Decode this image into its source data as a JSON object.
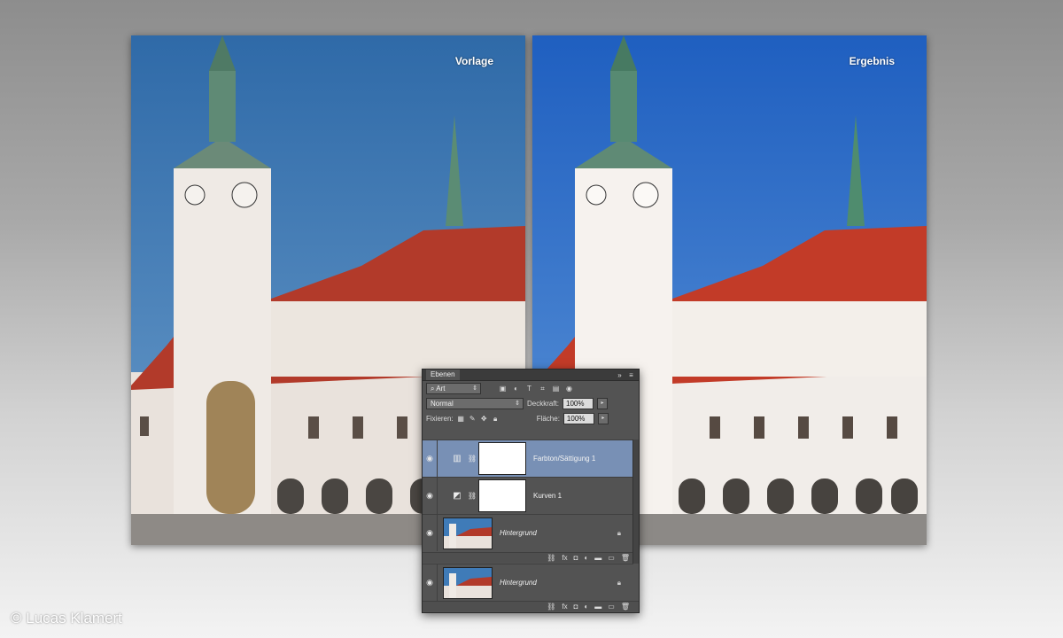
{
  "photos": {
    "left_label": "Vorlage",
    "right_label": "Ergebnis"
  },
  "credit": "© Lucas Klamert",
  "panel": {
    "tab": "Ebenen",
    "filter_kind": "Art",
    "blend_mode": "Normal",
    "opacity_label": "Deckkraft:",
    "opacity_value": "100%",
    "lock_label": "Fixieren:",
    "fill_label": "Fläche:",
    "fill_value": "100%",
    "layers": [
      {
        "name": "Farbton/Sättigung 1",
        "type": "adjustment",
        "selected": true
      },
      {
        "name": "Kurven 1",
        "type": "adjustment",
        "selected": false
      },
      {
        "name": "Hintergrund",
        "type": "image",
        "selected": false
      },
      {
        "name": "Hintergrund",
        "type": "image",
        "selected": false
      }
    ]
  },
  "colors": {
    "sky_before": "#3f7bb8",
    "sky_after": "#2f72c9",
    "roof": "#b23a2a",
    "selected_layer": "#7890b5"
  }
}
